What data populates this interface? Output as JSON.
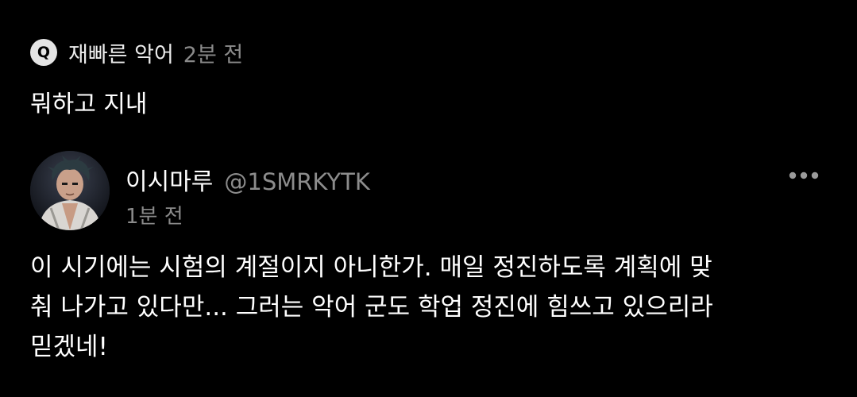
{
  "question": {
    "badge": "Q",
    "asker_name": "재빠른 악어",
    "time": "2분 전",
    "text": "뭐하고 지내"
  },
  "answer": {
    "author_name": "이시마루",
    "author_handle": "@1SMRKYTK",
    "time": "1분 전",
    "text": "이 시기에는 시험의 계절이지 아니한가. 매일 정진하도록 계획에 맞\n춰 나가고 있다만... 그러는 악어 군도 학업 정진에 힘쓰고 있으리라\n믿겠네!"
  },
  "icons": {
    "more": "more-horizontal-icon",
    "avatar": "profile-avatar"
  },
  "colors": {
    "background": "#000000",
    "text_primary": "#ffffff",
    "text_secondary": "#8a8a8a",
    "badge_bg": "#e4e4e4"
  }
}
